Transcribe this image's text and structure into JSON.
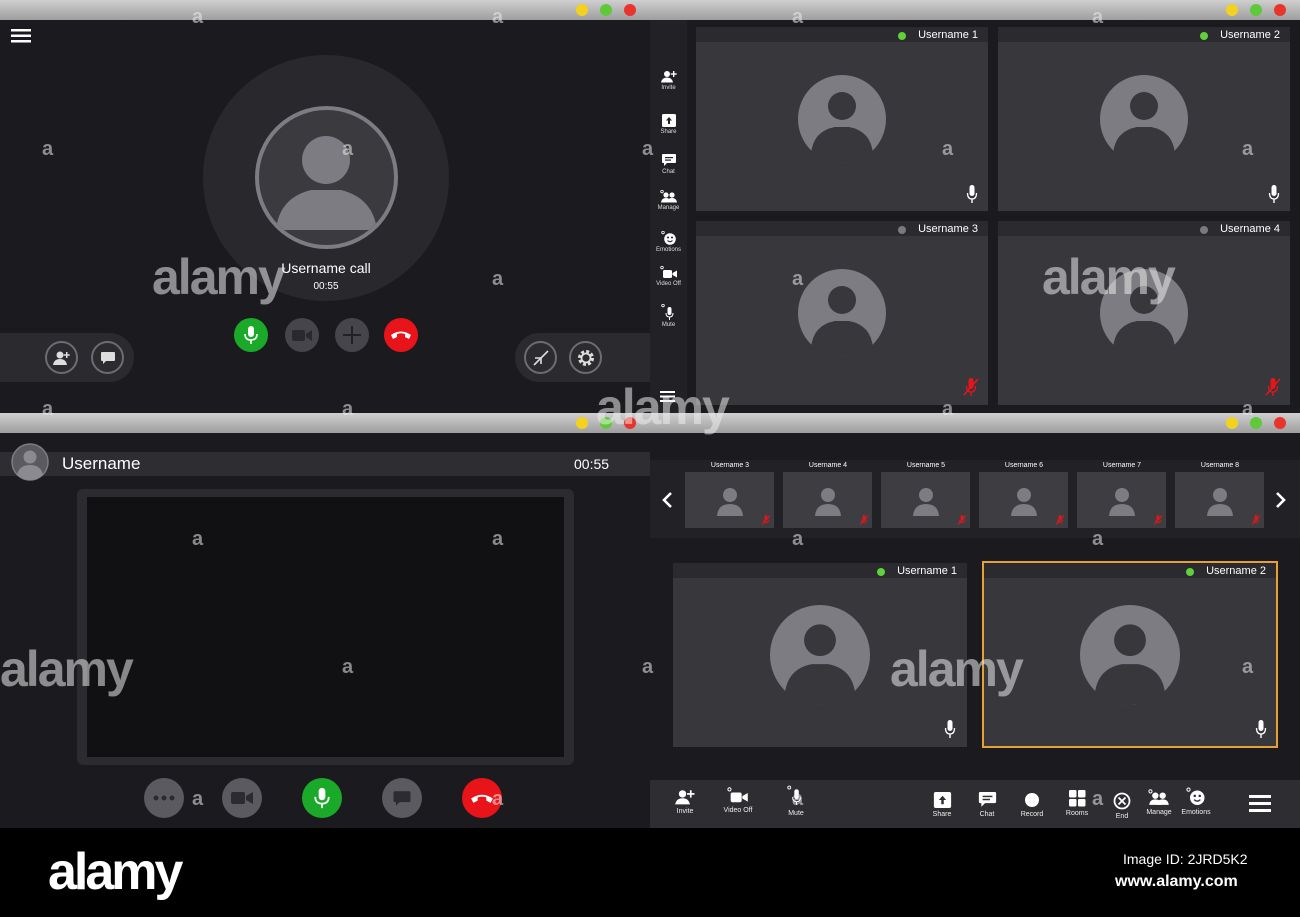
{
  "q1": {
    "caller_name": "Username call",
    "call_timer": "00:55"
  },
  "q2": {
    "sidebar": [
      {
        "label": "Invite",
        "icon": "invite-icon"
      },
      {
        "label": "Share",
        "icon": "share-icon"
      },
      {
        "label": "Chat",
        "icon": "chat-icon"
      },
      {
        "label": "Manage",
        "icon": "manage-icon"
      },
      {
        "label": "Emotions",
        "icon": "emotions-icon"
      },
      {
        "label": "Video Off",
        "icon": "video-icon"
      },
      {
        "label": "Mute",
        "icon": "mic-icon"
      }
    ],
    "tiles": [
      {
        "name": "Username 1",
        "status": "online",
        "mic": "on"
      },
      {
        "name": "Username 2",
        "status": "online",
        "mic": "on"
      },
      {
        "name": "Username 3",
        "status": "offline",
        "mic": "muted"
      },
      {
        "name": "Username 4",
        "status": "offline",
        "mic": "muted"
      }
    ]
  },
  "q3": {
    "username": "Username",
    "timer": "00:55"
  },
  "q4": {
    "thumbnails": [
      "Username 3",
      "Username 4",
      "Username 5",
      "Username 6",
      "Username 7",
      "Username 8"
    ],
    "tiles": [
      {
        "name": "Username 1",
        "status": "online"
      },
      {
        "name": "Username 2",
        "status": "online",
        "active": true
      }
    ],
    "toolbar_left": [
      "Invite",
      "Video Off",
      "Mute"
    ],
    "toolbar_right": [
      "Share",
      "Chat",
      "Record",
      "Rooms",
      "End",
      "Manage",
      "Emotions"
    ]
  },
  "colors": {
    "green": "#1aa928",
    "red": "#e8141a",
    "active_border": "#e7a033",
    "online": "#5fd13a",
    "offline": "#7a7a7a"
  },
  "watermark": {
    "brand": "alamy",
    "image_id": "Image ID: 2JRD5K2",
    "url": "www.alamy.com",
    "mark": "a"
  }
}
